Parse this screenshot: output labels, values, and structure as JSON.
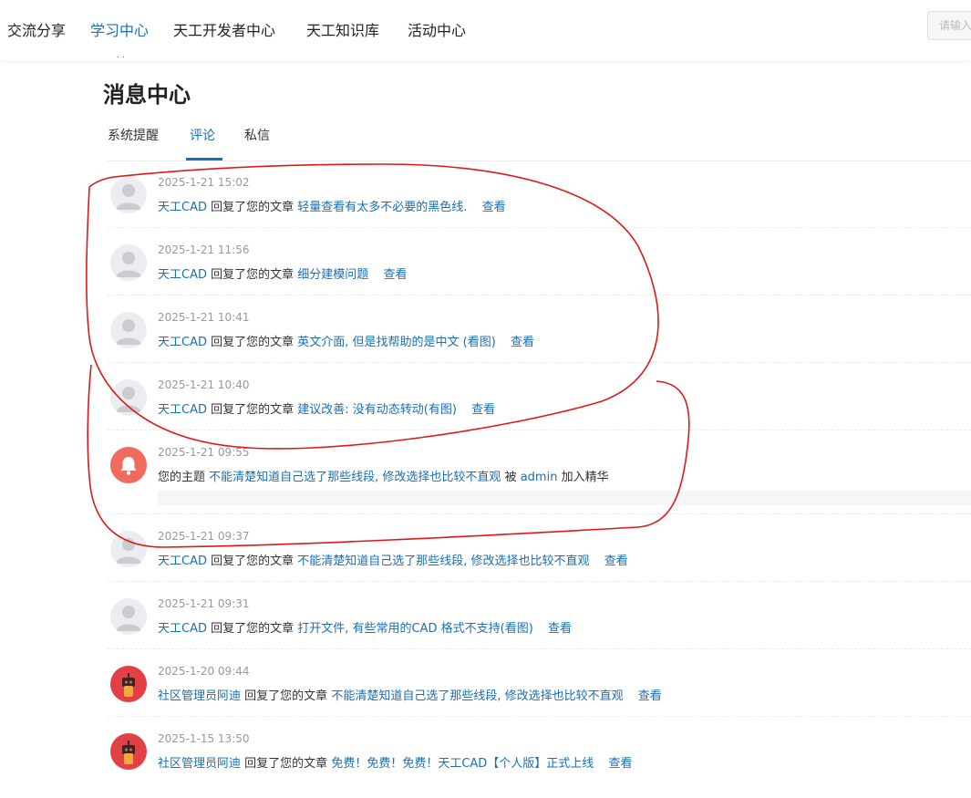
{
  "nav": {
    "items": [
      "交流分享",
      "学习中心",
      "天工开发者中心",
      "天工知识库",
      "活动中心"
    ],
    "active_index": 1,
    "dots": "..",
    "search_placeholder": "请输入"
  },
  "page": {
    "title": "消息中心",
    "tabs": [
      "系统提醒",
      "评论",
      "私信"
    ],
    "active_tab": 1
  },
  "colors": {
    "link": "#1a6fb5",
    "annotation": "#e01818"
  },
  "messages": [
    {
      "time": "2025-1-21 15:02",
      "user": "天工CAD",
      "action": "回复了您的文章",
      "title": "轻量查看有太多不必要的黑色线.",
      "view": "查看",
      "avatar": "default-avatar-icon"
    },
    {
      "time": "2025-1-21 11:56",
      "user": "天工CAD",
      "action": "回复了您的文章",
      "title": "细分建模问题",
      "view": "查看",
      "avatar": "default-avatar-icon"
    },
    {
      "time": "2025-1-21 10:41",
      "user": "天工CAD",
      "action": "回复了您的文章",
      "title": "英文介面, 但是找帮助的是中文 (看图)",
      "view": "查看",
      "avatar": "default-avatar-icon"
    },
    {
      "time": "2025-1-21 10:40",
      "user": "天工CAD",
      "action": "回复了您的文章",
      "title": "建议改善: 没有动态转动(有图)",
      "view": "查看",
      "avatar": "default-avatar-icon"
    },
    {
      "time": "2025-1-21 09:55",
      "prefix": "您的主题",
      "title": "不能清楚知道自己选了那些线段, 修改选择也比较不直观",
      "by": "被",
      "user": "admin",
      "suffix": "加入精华",
      "avatar": "bell-icon"
    },
    {
      "time": "2025-1-21 09:37",
      "user": "天工CAD",
      "action": "回复了您的文章",
      "title": "不能清楚知道自己选了那些线段, 修改选择也比较不直观",
      "view": "查看",
      "avatar": "default-avatar-icon"
    },
    {
      "time": "2025-1-21 09:31",
      "user": "天工CAD",
      "action": "回复了您的文章",
      "title": "打开文件, 有些常用的CAD 格式不支持(看图)",
      "view": "查看",
      "avatar": "default-avatar-icon"
    },
    {
      "time": "2025-1-20 09:44",
      "user": "社区管理员阿迪",
      "action": "回复了您的文章",
      "title": "不能清楚知道自己选了那些线段, 修改选择也比较不直观",
      "view": "查看",
      "avatar": "admin-avatar-icon"
    },
    {
      "time": "2025-1-15 13:50",
      "user": "社区管理员阿迪",
      "action": "回复了您的文章",
      "title": "免费！免费！免费！天工CAD【个人版】正式上线",
      "view": "查看",
      "avatar": "admin-avatar-icon"
    }
  ]
}
